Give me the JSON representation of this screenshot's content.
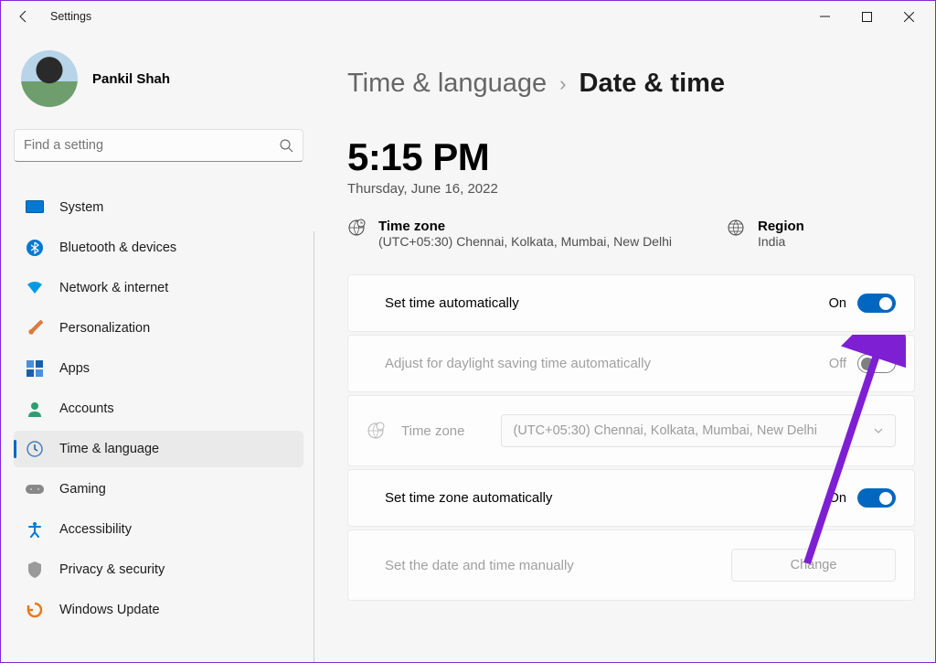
{
  "window": {
    "title": "Settings"
  },
  "user": {
    "name": "Pankil Shah"
  },
  "search": {
    "placeholder": "Find a setting"
  },
  "nav": {
    "items": [
      {
        "label": "System",
        "icon": "system"
      },
      {
        "label": "Bluetooth & devices",
        "icon": "bluetooth"
      },
      {
        "label": "Network & internet",
        "icon": "wifi"
      },
      {
        "label": "Personalization",
        "icon": "brush"
      },
      {
        "label": "Apps",
        "icon": "apps"
      },
      {
        "label": "Accounts",
        "icon": "person"
      },
      {
        "label": "Time & language",
        "icon": "clock"
      },
      {
        "label": "Gaming",
        "icon": "game"
      },
      {
        "label": "Accessibility",
        "icon": "accessibility"
      },
      {
        "label": "Privacy & security",
        "icon": "shield"
      },
      {
        "label": "Windows Update",
        "icon": "update"
      }
    ],
    "active_index": 6
  },
  "breadcrumb": {
    "parent": "Time & language",
    "current": "Date & time"
  },
  "clock": {
    "time": "5:15 PM",
    "date": "Thursday, June 16, 2022"
  },
  "info": {
    "timezone": {
      "title": "Time zone",
      "value": "(UTC+05:30) Chennai, Kolkata, Mumbai, New Delhi"
    },
    "region": {
      "title": "Region",
      "value": "India"
    }
  },
  "settings": {
    "auto_time": {
      "label": "Set time automatically",
      "state": "On"
    },
    "daylight": {
      "label": "Adjust for daylight saving time automatically",
      "state": "Off"
    },
    "timezone_picker": {
      "label": "Time zone",
      "value": "(UTC+05:30) Chennai, Kolkata, Mumbai, New Delhi"
    },
    "auto_tz": {
      "label": "Set time zone automatically",
      "state": "On"
    },
    "manual": {
      "label": "Set the date and time manually",
      "button": "Change"
    }
  },
  "colors": {
    "accent": "#0067c0",
    "annotation": "#7e1fd4"
  }
}
